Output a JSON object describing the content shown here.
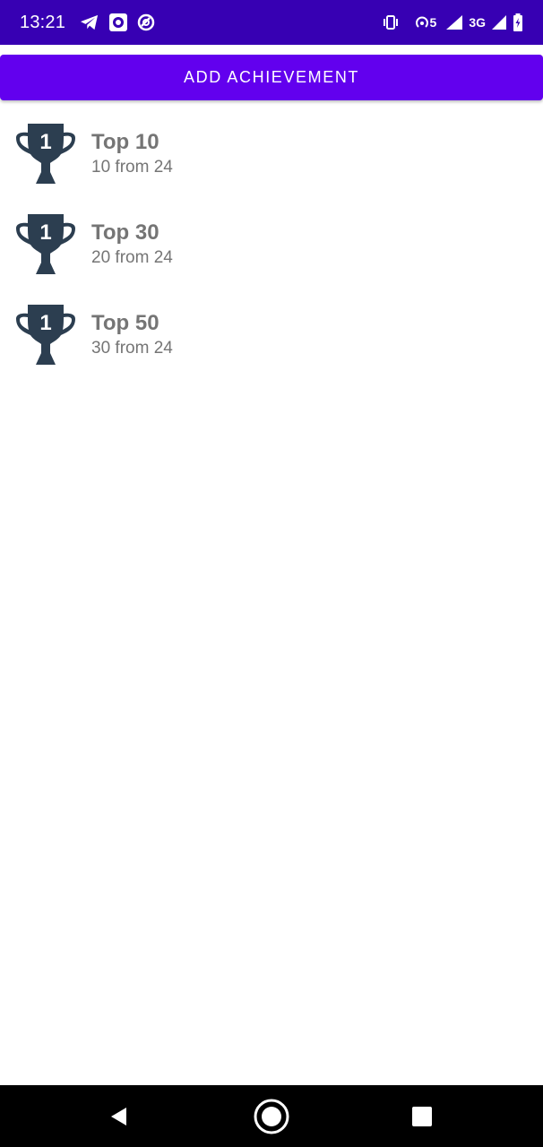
{
  "status_bar": {
    "time": "13:21",
    "background": "#3700b3",
    "left_icons": [
      "telegram-icon",
      "camera-record-icon",
      "at-sign-icon"
    ],
    "right_icons": [
      "vibrate-icon",
      "hotspot-icon",
      "wifi-signal-icon",
      "mobile-signal-icon",
      "battery-charging-icon"
    ],
    "hotspot_count": "5",
    "network_type": "3G"
  },
  "add_button": {
    "label": "ADD ACHIEVEMENT",
    "color": "#6200ee"
  },
  "achievements": [
    {
      "icon": "trophy-icon",
      "badge": "1",
      "title": "Top 10",
      "subtitle": "10 from 24"
    },
    {
      "icon": "trophy-icon",
      "badge": "1",
      "title": "Top 30",
      "subtitle": "20 from 24"
    },
    {
      "icon": "trophy-icon",
      "badge": "1",
      "title": "Top 50",
      "subtitle": "30 from 24"
    }
  ],
  "trophy_color": "#2c3e50",
  "nav_bar": {
    "buttons": [
      "back-icon",
      "home-icon",
      "recents-icon"
    ]
  }
}
